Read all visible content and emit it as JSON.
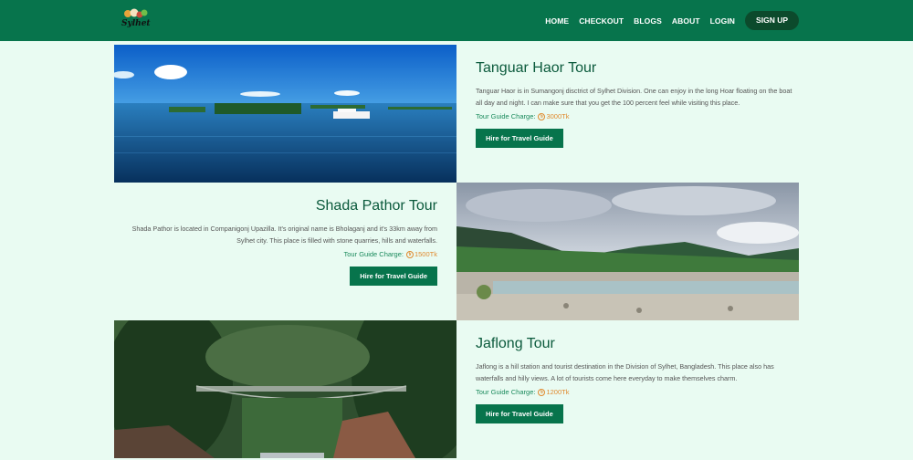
{
  "header": {
    "logo_text": "Sylhet",
    "nav": [
      {
        "label": "HOME"
      },
      {
        "label": "CHECKOUT"
      },
      {
        "label": "BLOGS"
      },
      {
        "label": "ABOUT"
      },
      {
        "label": "LOGIN"
      }
    ],
    "signup_label": "SIGN UP"
  },
  "tours": [
    {
      "title": "Tanguar Haor Tour",
      "description": "Tanguar Haor is in Sumangonj disctrict of Sylhet Division. One can enjoy in the long Hoar floating on the boat all day and night. I can make sure that you get the 100 percent feel while visiting this place.",
      "charge_label": "Tour Guide Charge:",
      "price": "3000Tk",
      "button_label": "Hire for Travel Guide",
      "image": "lake-boat-photo"
    },
    {
      "title": "Shada Pathor Tour",
      "description": "Shada Pathor is located in Companigonj Upazilla. It's original name is Bholaganj and it's 33km away from Sylhet city. This place is filled with stone quarries, hills and waterfalls.",
      "charge_label": "Tour Guide Charge:",
      "price": "1500Tk",
      "button_label": "Hire for Travel Guide",
      "image": "stone-river-hills-photo"
    },
    {
      "title": "Jaflong Tour",
      "description": "Jaflong is a hill station and tourist destination in the Division of Sylhet, Bangladesh. This place also has waterfalls and hilly views. A lot of tourists come here everyday to make themselves charm.",
      "charge_label": "Tour Guide Charge:",
      "price": "1200Tk",
      "button_label": "Hire for Travel Guide",
      "image": "suspension-bridge-forest-photo"
    }
  ],
  "colors": {
    "navbar": "#07744c",
    "page_bg": "#e9fbf2",
    "title": "#0b5a3c",
    "price": "#e08a2e",
    "button": "#07744c"
  }
}
